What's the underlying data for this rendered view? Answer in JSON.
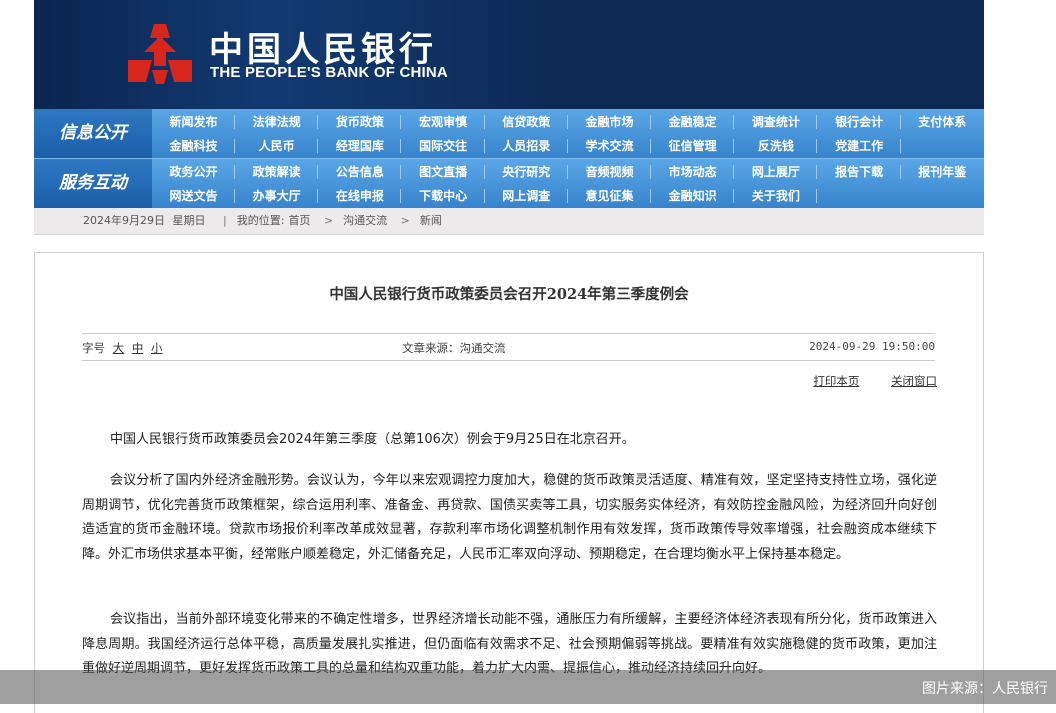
{
  "header": {
    "title_cn": "中国人民银行",
    "title_en": "THE PEOPLE'S BANK OF CHINA",
    "logo_icon": "pboc-emblem-icon",
    "bg_color": "#0d2a55"
  },
  "nav": {
    "group1_label": "信息公开",
    "group2_label": "服务互动",
    "row1": [
      "新闻发布",
      "法律法规",
      "货币政策",
      "宏观审慎",
      "信贷政策",
      "金融市场",
      "金融稳定",
      "调查统计",
      "银行会计",
      "支付体系"
    ],
    "row2": [
      "金融科技",
      "人民币",
      "经理国库",
      "国际交往",
      "人员招录",
      "学术交流",
      "征信管理",
      "反洗钱",
      "党建工作"
    ],
    "row3": [
      "政务公开",
      "政策解读",
      "公告信息",
      "图文直播",
      "央行研究",
      "音频视频",
      "市场动态",
      "网上展厅",
      "报告下载",
      "报刊年鉴"
    ],
    "row4": [
      "网送文告",
      "办事大厅",
      "在线申报",
      "下载中心",
      "网上调查",
      "意见征集",
      "金融知识",
      "关于我们"
    ],
    "accent_color": "#3f90d8"
  },
  "breadcrumb": {
    "date": "2024年9月29日",
    "weekday": "星期日",
    "location_prefix": "我的位置:",
    "items": [
      "首页",
      "沟通交流",
      "新闻"
    ]
  },
  "article": {
    "title": "中国人民银行货币政策委员会召开2024年第三季度例会",
    "font_size_label": "字号",
    "font_sizes": [
      "大",
      "中",
      "小"
    ],
    "source": "文章来源：沟通交流",
    "datetime": "2024-09-29 19:50:00",
    "print_label": "打印本页",
    "close_label": "关闭窗口",
    "paragraphs": [
      "中国人民银行货币政策委员会2024年第三季度（总第106次）例会于9月25日在北京召开。",
      "会议分析了国内外经济金融形势。会议认为，今年以来宏观调控力度加大，稳健的货币政策灵活适度、精准有效，坚定坚持支持性立场，强化逆周期调节，优化完善货币政策框架，综合运用利率、准备金、再贷款、国债买卖等工具，切实服务实体经济，有效防控金融风险，为经济回升向好创造适宜的货币金融环境。贷款市场报价利率改革成效显著，存款利率市场化调整机制作用有效发挥，货币政策传导效率增强，社会融资成本继续下降。外汇市场供求基本平衡，经常账户顺差稳定，外汇储备充足，人民币汇率双向浮动、预期稳定，在合理均衡水平上保持基本稳定。",
      "会议指出，当前外部环境变化带来的不确定性增多，世界经济增长动能不强，通胀压力有所缓解，主要经济体经济表现有所分化，货币政策进入降息周期。我国经济运行总体平稳，高质量发展扎实推进，但仍面临有效需求不足、社会预期偏弱等挑战。要精准有效实施稳健的货币政策，更加注重做好逆周期调节，更好发挥货币政策工具的总量和结构双重功能，着力扩大内需、提振信心，推动经济持续回升向好。"
    ]
  },
  "watermark": "图片来源：人民银行"
}
